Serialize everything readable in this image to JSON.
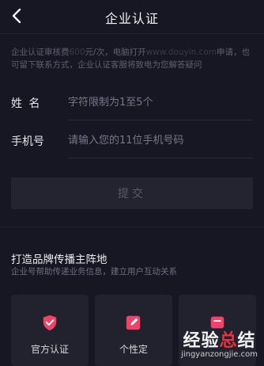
{
  "header": {
    "title": "企业认证",
    "back_icon": "back-arrow-icon"
  },
  "notice": {
    "part1": "企业认证审核费",
    "fee": "600",
    "part2": "元/次，电脑打开",
    "url": "www.douyin.com",
    "part3": "申请，也可留下联系方式，企业认证客服将致电为您解答疑问"
  },
  "form": {
    "name_label": "姓 名",
    "name_placeholder": "字符限制为1至5个",
    "phone_label": "手机号",
    "phone_placeholder": "请输入您的11位手机号码",
    "submit_label": "提交"
  },
  "section": {
    "title": "打造品牌传播主阵地",
    "subtitle": "企业号帮助传递业务信息，建立用户互动关系"
  },
  "cards": [
    {
      "label": "官方认证",
      "icon": "shield-check-icon",
      "color": "#f0436a"
    },
    {
      "label": "个性定",
      "icon": "edit-card-icon",
      "color": "#f0436a"
    },
    {
      "label": "",
      "icon": "card-icon",
      "color": "#f0436a"
    }
  ],
  "watermark": {
    "line1_a": "经验",
    "line1_b": "总",
    "line1_c": "结",
    "line2": "jingyanzongjie.com"
  }
}
